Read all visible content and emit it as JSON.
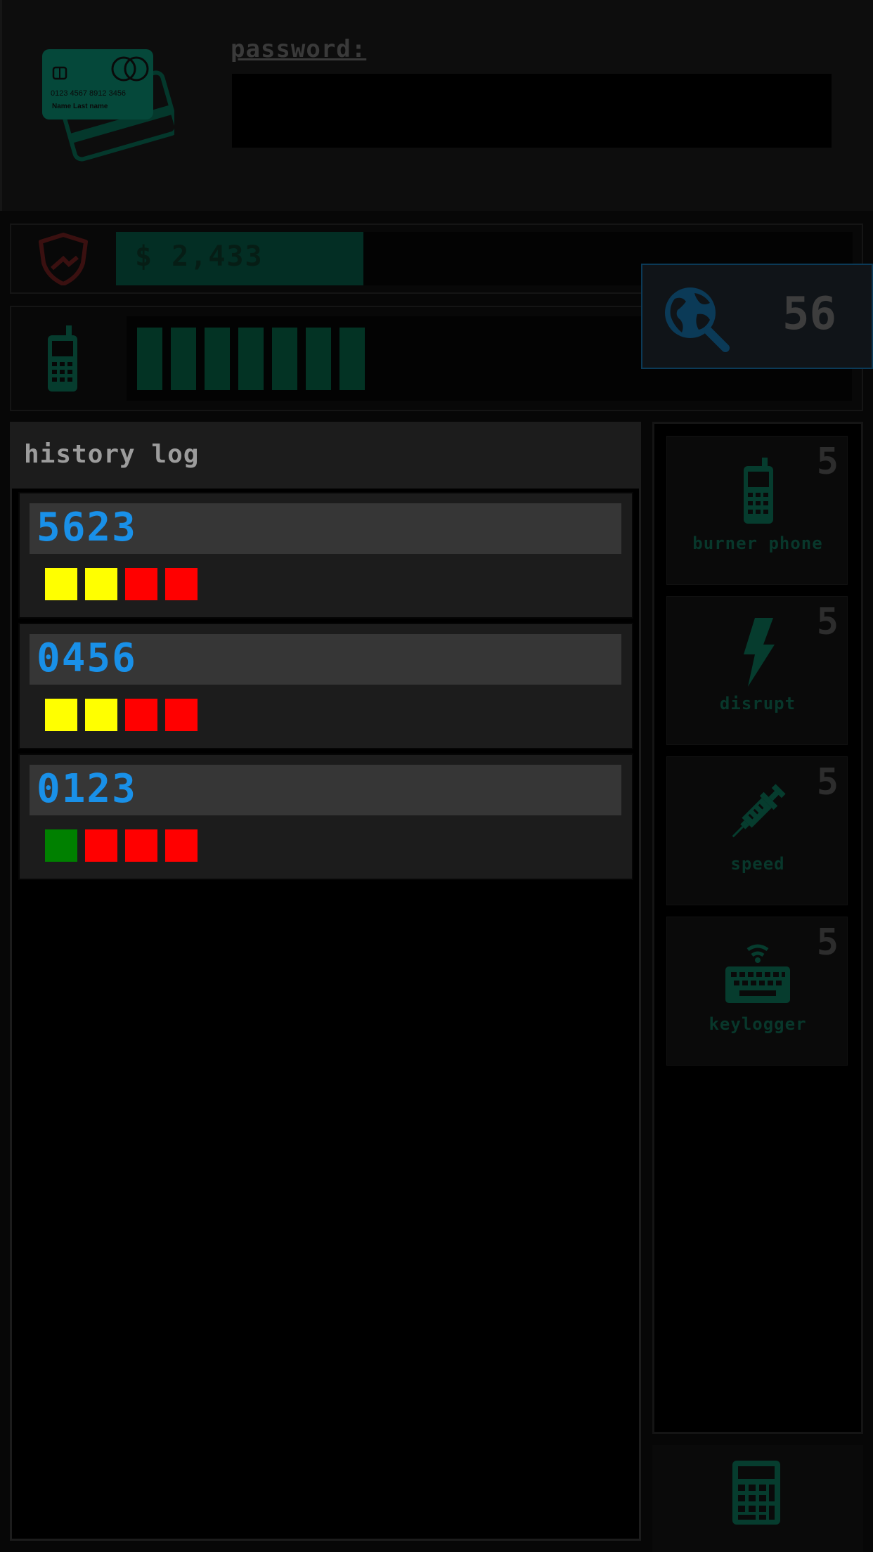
{
  "colors": {
    "accent_green": "#06493a",
    "code_blue": "#1990e8",
    "feedback_yellow": "#ffff00",
    "feedback_red": "#ff0000",
    "feedback_green": "#008000",
    "shield_red": "#3a1010"
  },
  "header": {
    "card": {
      "number": "0123  4567  8912  3456",
      "name": "Name  Last name",
      "icon": "credit-card-icon"
    },
    "password_label": "password:",
    "password_value": ""
  },
  "money": {
    "icon": "shield-icon",
    "text": "$ 2,433",
    "fill_fraction": 0.336
  },
  "signal": {
    "icon": "cell-phone-icon",
    "bars_filled": 7
  },
  "search": {
    "icon": "globe-search-icon",
    "count": "56"
  },
  "history": {
    "title": "history log",
    "entries": [
      {
        "code": "5623",
        "feedback": [
          "yellow",
          "yellow",
          "red",
          "red"
        ]
      },
      {
        "code": "0456",
        "feedback": [
          "yellow",
          "yellow",
          "red",
          "red"
        ]
      },
      {
        "code": "0123",
        "feedback": [
          "green",
          "red",
          "red",
          "red"
        ]
      }
    ]
  },
  "tools": [
    {
      "label": "burner phone",
      "count": "5",
      "icon": "cell-phone-icon"
    },
    {
      "label": "disrupt",
      "count": "5",
      "icon": "lightning-bolt-icon"
    },
    {
      "label": "speed",
      "count": "5",
      "icon": "syringe-icon"
    },
    {
      "label": "keylogger",
      "count": "5",
      "icon": "keyboard-wifi-icon"
    }
  ],
  "calculator": {
    "icon": "calculator-icon"
  }
}
